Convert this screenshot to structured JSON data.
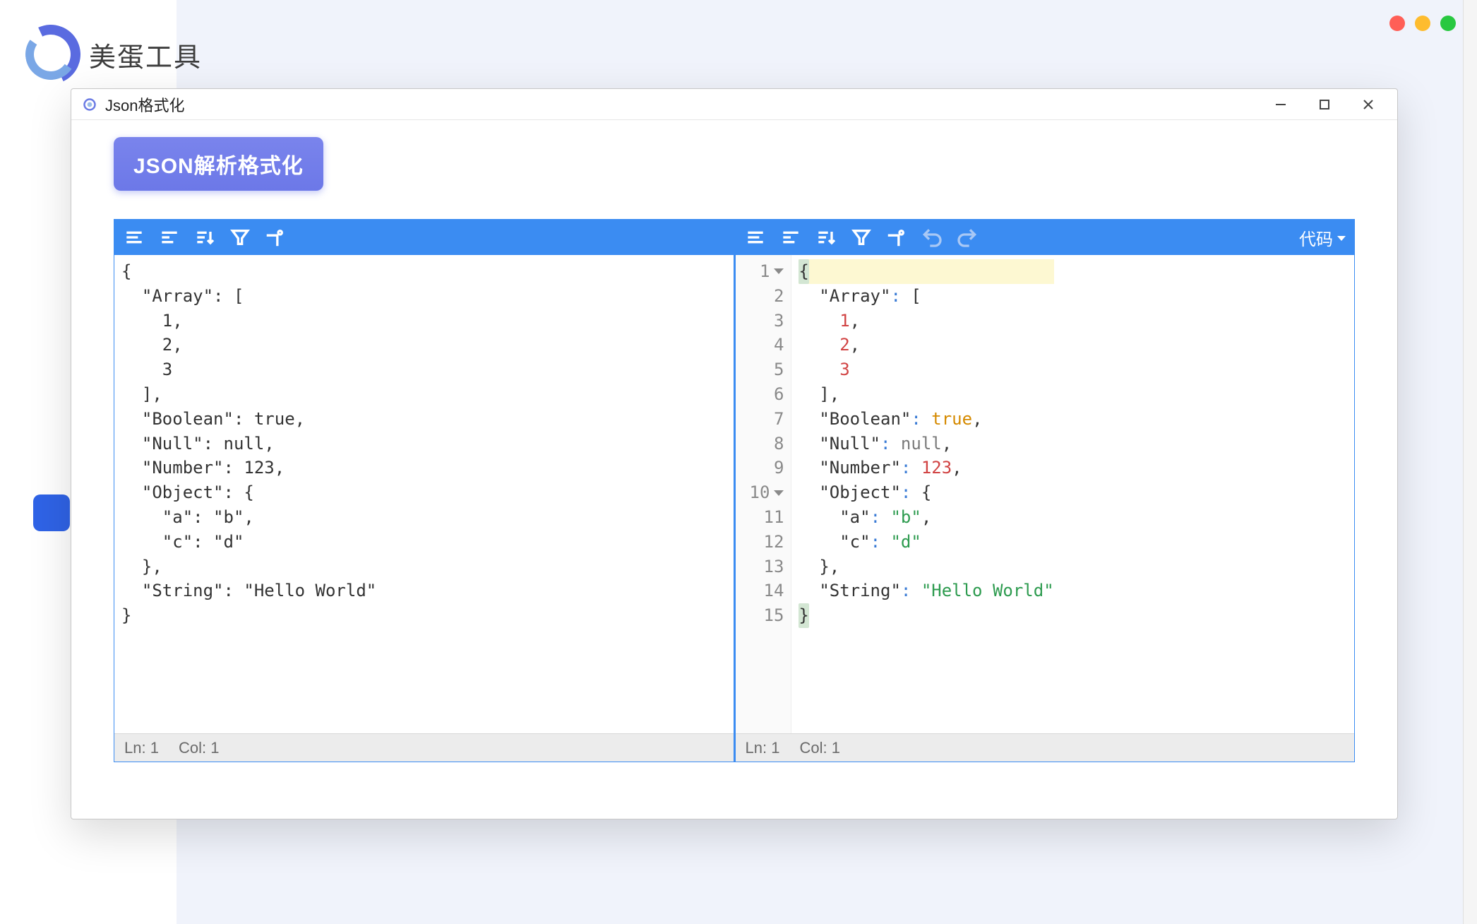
{
  "app": {
    "name": "美蛋工具"
  },
  "window": {
    "title": "Json格式化"
  },
  "format_button": {
    "label": "JSON解析格式化"
  },
  "left_pane": {
    "toolbar": {
      "tools": [
        "expand",
        "collapse",
        "sort",
        "filter",
        "settings"
      ]
    },
    "raw_text": "{\n  \"Array\": [\n    1,\n    2,\n    3\n  ],\n  \"Boolean\": true,\n  \"Null\": null,\n  \"Number\": 123,\n  \"Object\": {\n    \"a\": \"b\",\n    \"c\": \"d\"\n  },\n  \"String\": \"Hello World\"\n}",
    "status": {
      "ln_label": "Ln:",
      "ln": "1",
      "col_label": "Col:",
      "col": "1"
    }
  },
  "right_pane": {
    "toolbar": {
      "tools": [
        "expand",
        "collapse",
        "sort",
        "filter",
        "settings",
        "undo",
        "redo"
      ],
      "view_dropdown": {
        "label": "代码"
      }
    },
    "lines": [
      {
        "n": 1,
        "fold": true,
        "tokens": [
          {
            "t": "{",
            "c": "plain",
            "hl": true
          }
        ]
      },
      {
        "n": 2,
        "fold": false,
        "tokens": [
          {
            "t": "  ",
            "c": "plain"
          },
          {
            "t": "\"Array\"",
            "c": "key"
          },
          {
            "t": ": ",
            "c": "colon"
          },
          {
            "t": "[",
            "c": "plain"
          }
        ]
      },
      {
        "n": 3,
        "fold": false,
        "tokens": [
          {
            "t": "    ",
            "c": "plain"
          },
          {
            "t": "1",
            "c": "num"
          },
          {
            "t": ",",
            "c": "plain"
          }
        ]
      },
      {
        "n": 4,
        "fold": false,
        "tokens": [
          {
            "t": "    ",
            "c": "plain"
          },
          {
            "t": "2",
            "c": "num"
          },
          {
            "t": ",",
            "c": "plain"
          }
        ]
      },
      {
        "n": 5,
        "fold": false,
        "tokens": [
          {
            "t": "    ",
            "c": "plain"
          },
          {
            "t": "3",
            "c": "num"
          }
        ]
      },
      {
        "n": 6,
        "fold": false,
        "tokens": [
          {
            "t": "  ",
            "c": "plain"
          },
          {
            "t": "],",
            "c": "plain"
          }
        ]
      },
      {
        "n": 7,
        "fold": false,
        "tokens": [
          {
            "t": "  ",
            "c": "plain"
          },
          {
            "t": "\"Boolean\"",
            "c": "key"
          },
          {
            "t": ": ",
            "c": "colon"
          },
          {
            "t": "true",
            "c": "bool"
          },
          {
            "t": ",",
            "c": "plain"
          }
        ]
      },
      {
        "n": 8,
        "fold": false,
        "tokens": [
          {
            "t": "  ",
            "c": "plain"
          },
          {
            "t": "\"Null\"",
            "c": "key"
          },
          {
            "t": ": ",
            "c": "colon"
          },
          {
            "t": "null",
            "c": "null"
          },
          {
            "t": ",",
            "c": "plain"
          }
        ]
      },
      {
        "n": 9,
        "fold": false,
        "tokens": [
          {
            "t": "  ",
            "c": "plain"
          },
          {
            "t": "\"Number\"",
            "c": "key"
          },
          {
            "t": ": ",
            "c": "colon"
          },
          {
            "t": "123",
            "c": "num"
          },
          {
            "t": ",",
            "c": "plain"
          }
        ]
      },
      {
        "n": 10,
        "fold": true,
        "tokens": [
          {
            "t": "  ",
            "c": "plain"
          },
          {
            "t": "\"Object\"",
            "c": "key"
          },
          {
            "t": ": ",
            "c": "colon"
          },
          {
            "t": "{",
            "c": "plain"
          }
        ]
      },
      {
        "n": 11,
        "fold": false,
        "tokens": [
          {
            "t": "    ",
            "c": "plain"
          },
          {
            "t": "\"a\"",
            "c": "key"
          },
          {
            "t": ": ",
            "c": "colon"
          },
          {
            "t": "\"b\"",
            "c": "str"
          },
          {
            "t": ",",
            "c": "plain"
          }
        ]
      },
      {
        "n": 12,
        "fold": false,
        "tokens": [
          {
            "t": "    ",
            "c": "plain"
          },
          {
            "t": "\"c\"",
            "c": "key"
          },
          {
            "t": ": ",
            "c": "colon"
          },
          {
            "t": "\"d\"",
            "c": "str"
          }
        ]
      },
      {
        "n": 13,
        "fold": false,
        "tokens": [
          {
            "t": "  ",
            "c": "plain"
          },
          {
            "t": "},",
            "c": "plain"
          }
        ]
      },
      {
        "n": 14,
        "fold": false,
        "tokens": [
          {
            "t": "  ",
            "c": "plain"
          },
          {
            "t": "\"String\"",
            "c": "key"
          },
          {
            "t": ": ",
            "c": "colon"
          },
          {
            "t": "\"Hello World\"",
            "c": "str"
          }
        ]
      },
      {
        "n": 15,
        "fold": false,
        "tokens": [
          {
            "t": "}",
            "c": "plain",
            "hl": true
          }
        ]
      }
    ],
    "status": {
      "ln_label": "Ln:",
      "ln": "1",
      "col_label": "Col:",
      "col": "1"
    }
  },
  "json_value": {
    "Array": [
      1,
      2,
      3
    ],
    "Boolean": true,
    "Null": null,
    "Number": 123,
    "Object": {
      "a": "b",
      "c": "d"
    },
    "String": "Hello World"
  }
}
